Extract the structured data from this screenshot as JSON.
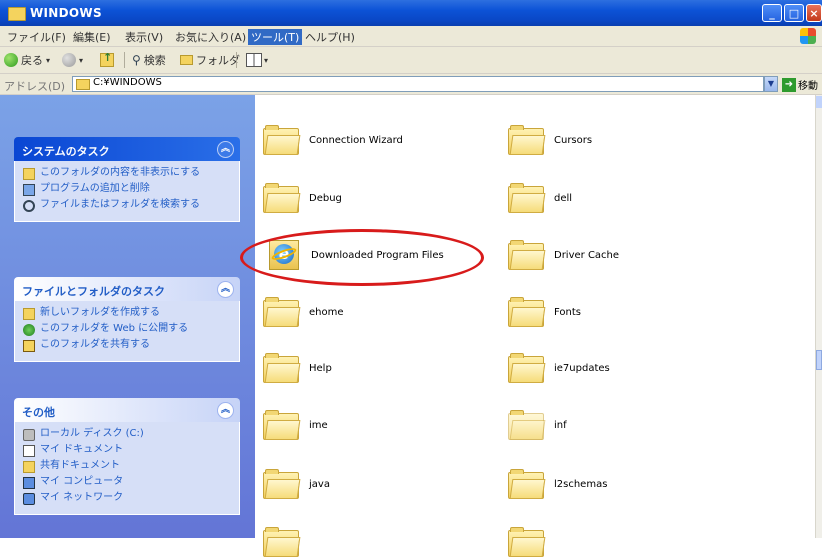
{
  "window": {
    "title": "WINDOWS"
  },
  "menu": [
    {
      "label": "ファイル(F)",
      "active": false
    },
    {
      "label": "編集(E)",
      "active": false
    },
    {
      "label": "表示(V)",
      "active": false
    },
    {
      "label": "お気に入り(A)",
      "active": false
    },
    {
      "label": "ツール(T)",
      "active": true
    },
    {
      "label": "ヘルプ(H)",
      "active": false
    }
  ],
  "toolbar": {
    "back_label": "戻る",
    "search_label": "検索",
    "folders_label": "フォルダ"
  },
  "address": {
    "label": "アドレス(D)",
    "value": "C:¥WINDOWS",
    "go_label": "移動"
  },
  "tasks": {
    "system": {
      "title": "システムのタスク",
      "items": [
        {
          "label": "このフォルダの内容を非表示にする",
          "icon": "folder-icon"
        },
        {
          "label": "プログラムの追加と削除",
          "icon": "add-remove-programs-icon"
        },
        {
          "label": "ファイルまたはフォルダを検索する",
          "icon": "search-icon"
        }
      ]
    },
    "file_folder": {
      "title": "ファイルとフォルダのタスク",
      "items": [
        {
          "label": "新しいフォルダを作成する",
          "icon": "new-folder-icon"
        },
        {
          "label": "このフォルダを Web に公開する",
          "icon": "web-publish-icon"
        },
        {
          "label": "このフォルダを共有する",
          "icon": "share-folder-icon"
        }
      ]
    },
    "other": {
      "title": "その他",
      "items": [
        {
          "label": "ローカル ディスク (C:)",
          "icon": "local-disk-icon"
        },
        {
          "label": "マイ ドキュメント",
          "icon": "my-documents-icon"
        },
        {
          "label": "共有ドキュメント",
          "icon": "shared-documents-icon"
        },
        {
          "label": "マイ コンピュータ",
          "icon": "my-computer-icon"
        },
        {
          "label": "マイ ネットワーク",
          "icon": "my-network-icon"
        }
      ]
    }
  },
  "files": [
    {
      "name": "Connection Wizard",
      "icon": "folder-icon"
    },
    {
      "name": "Cursors",
      "icon": "folder-icon"
    },
    {
      "name": "Debug",
      "icon": "folder-icon"
    },
    {
      "name": "dell",
      "icon": "folder-icon"
    },
    {
      "name": "Downloaded Program Files",
      "icon": "ie-folder-icon",
      "highlighted": true
    },
    {
      "name": "Driver Cache",
      "icon": "folder-icon"
    },
    {
      "name": "ehome",
      "icon": "folder-icon"
    },
    {
      "name": "Fonts",
      "icon": "folder-icon"
    },
    {
      "name": "Help",
      "icon": "folder-icon"
    },
    {
      "name": "ie7updates",
      "icon": "folder-icon"
    },
    {
      "name": "ime",
      "icon": "folder-icon"
    },
    {
      "name": "inf",
      "icon": "faded-folder-icon"
    },
    {
      "name": "java",
      "icon": "folder-icon"
    },
    {
      "name": "l2schemas",
      "icon": "folder-icon"
    }
  ],
  "colors": {
    "titlebar": "#0a47c5",
    "taskpane": "#6375d6",
    "highlight_ring": "#d81b1b",
    "link": "#215dc6"
  }
}
